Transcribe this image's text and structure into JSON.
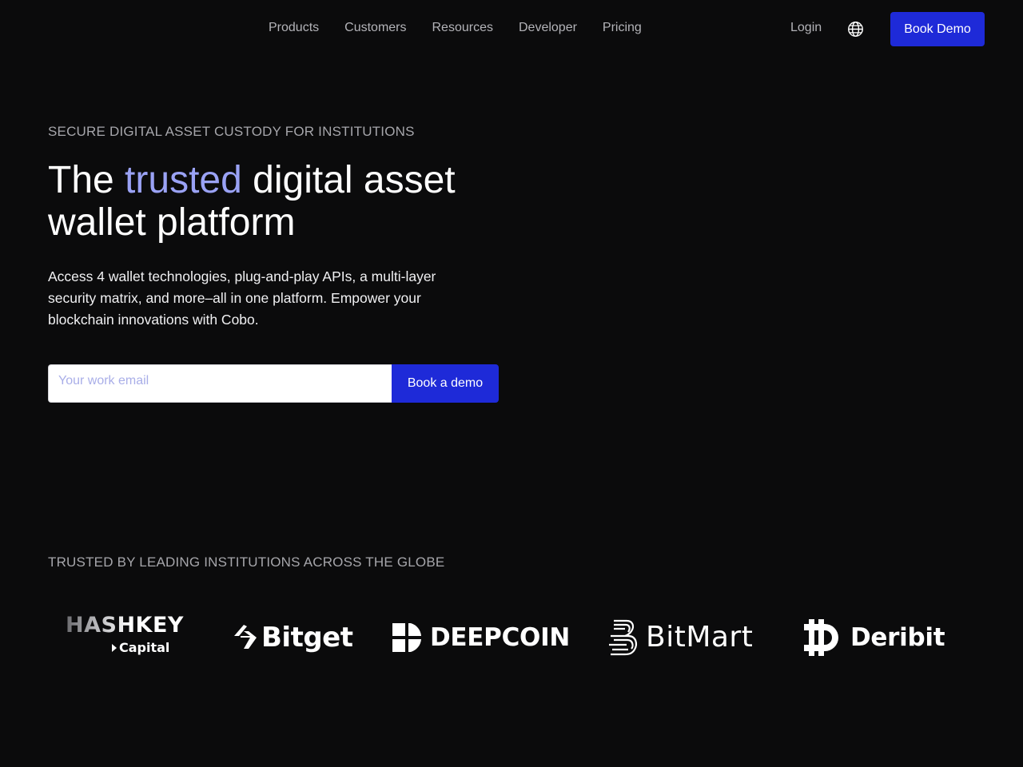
{
  "nav": {
    "items": [
      {
        "label": "Products"
      },
      {
        "label": "Customers"
      },
      {
        "label": "Resources"
      },
      {
        "label": "Developer"
      },
      {
        "label": "Pricing"
      }
    ],
    "login_label": "Login",
    "language_icon": "globe-icon",
    "cta_label": "Book Demo"
  },
  "hero": {
    "eyebrow": "SECURE DIGITAL ASSET CUSTODY FOR INSTITUTIONS",
    "headline_prefix": "The ",
    "headline_accent": "trusted",
    "headline_suffix": " digital asset wallet platform",
    "subtitle": "Access 4 wallet technologies, plug-and-play APIs, a multi-layer security matrix, and more–all in one platform. Empower your blockchain innovations with Cobo.",
    "email_placeholder": "Your work email",
    "email_value": "",
    "submit_label": "Book a demo"
  },
  "trusted": {
    "heading": "TRUSTED BY LEADING INSTITUTIONS ACROSS THE GLOBE",
    "logos": [
      {
        "name": "HASHKEY",
        "sub": "Capital",
        "icon": "hashkey-logo"
      },
      {
        "name": "Bitget",
        "icon": "bitget-mark-icon"
      },
      {
        "name": "DEEPCOIN",
        "icon": "deepcoin-mark-icon"
      },
      {
        "name": "BitMart",
        "icon": "bitmart-mark-icon"
      },
      {
        "name": "Deribit",
        "icon": "deribit-mark-icon"
      }
    ]
  },
  "colors": {
    "background": "#0b0b0c",
    "accent_text": "#9aa2f5",
    "primary_button": "#1e2ad8",
    "muted_text": "#a6a6ab"
  }
}
